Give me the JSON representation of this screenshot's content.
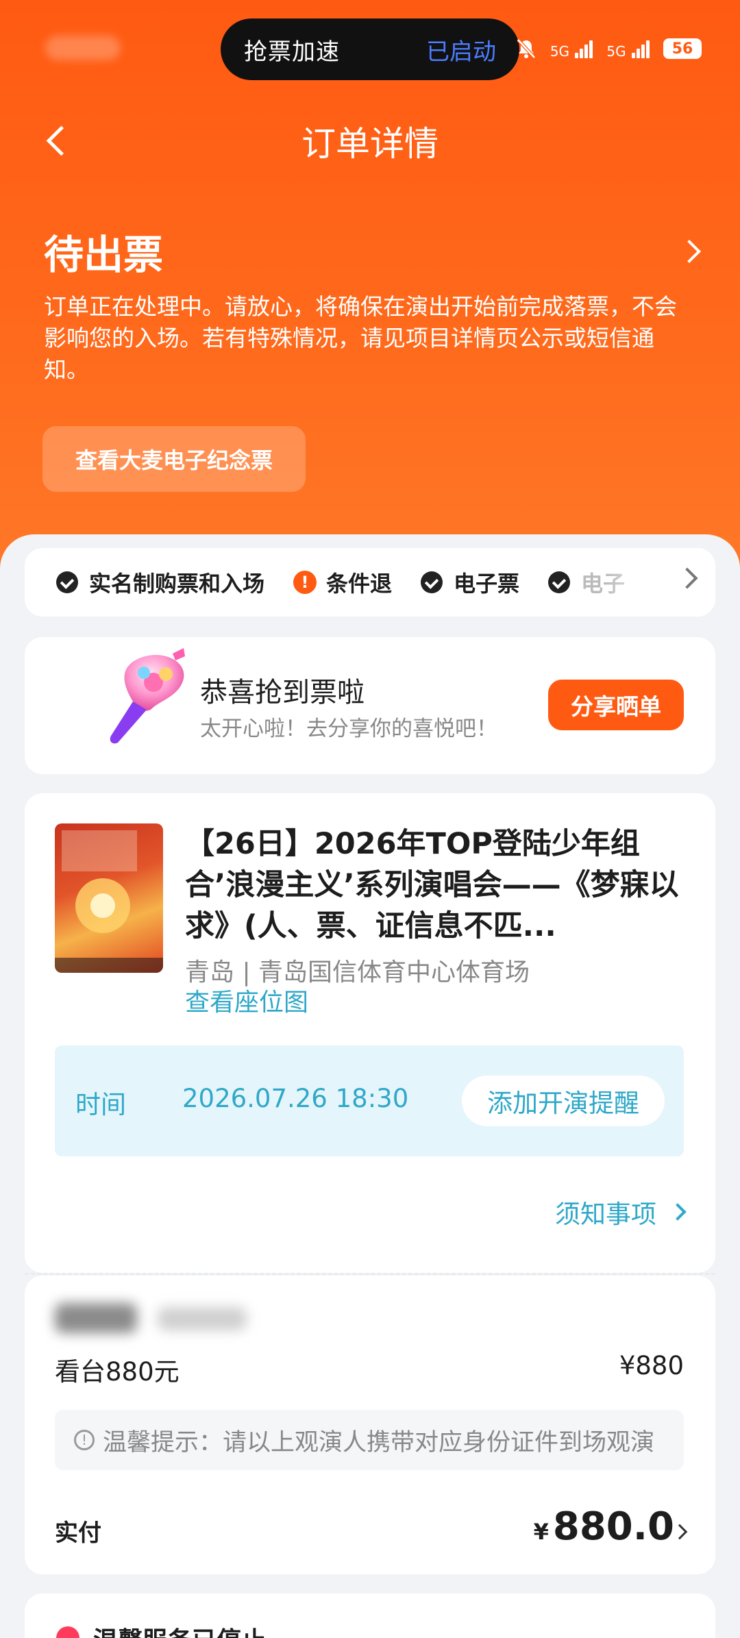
{
  "status_bar": {
    "pill_left": "抢票加速",
    "pill_right": "已启动",
    "signal1": "5G",
    "signal2": "5G",
    "battery": "56"
  },
  "header": {
    "title": "订单详情"
  },
  "order_status": {
    "title": "待出票",
    "description": "订单正在处理中。请放心，将确保在演出开始前完成落票，不会影响您的入场。若有特殊情况，请见项目详情页公示或短信通知。",
    "memo_button": "查看大麦电子纪念票"
  },
  "features": [
    {
      "label": "实名制购票和入场",
      "icon": "check-icon"
    },
    {
      "label": "条件退",
      "icon": "warning-icon"
    },
    {
      "label": "电子票",
      "icon": "check-icon"
    },
    {
      "label": "电子",
      "icon": "check-icon"
    }
  ],
  "congrats": {
    "title": "恭喜抢到票啦",
    "subtitle": "太开心啦！去分享你的喜悦吧！",
    "share_button": "分享晒单"
  },
  "show": {
    "title": "【26日】2026年TOP登陆少年组合’浪漫主义’系列演唱会——《梦寐以求》(人、票、证信息不匹...",
    "venue": "青岛 | 青岛国信体育中心体育场",
    "seat_map": "查看座位图",
    "time_label": "时间",
    "time_value": "2026.07.26 18:30",
    "remind_button": "添加开演提醒",
    "notice": "须知事项"
  },
  "ticket": {
    "tier": "看台880元",
    "price": "¥880",
    "tip": "温馨提示：请以上观演人携带对应身份证件到场观演",
    "paid_label": "实付",
    "paid_currency": "¥",
    "paid_amount": "880.0"
  },
  "bottom": {
    "text": "温馨服务已停止"
  },
  "colors": {
    "brand": "#ff5a12",
    "link": "#2fa8c8"
  }
}
